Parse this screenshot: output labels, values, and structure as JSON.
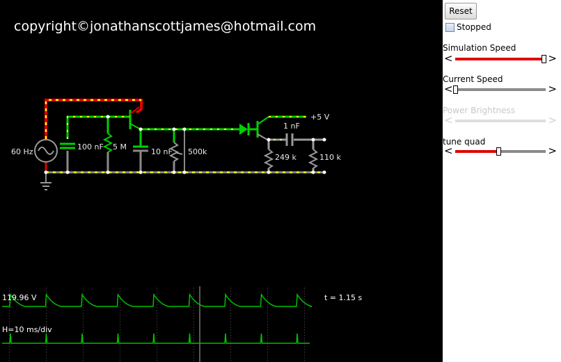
{
  "canvas": {
    "copyright": "copyright©jonathanscottjames@hotmail.com",
    "labels": {
      "source": "60 Hz",
      "cap1": "100 nF",
      "res1": "5 M",
      "cap2": "10 nF",
      "pot": "500k",
      "vcc": "+5 V",
      "cap3": "1 nF",
      "res2": "249 k",
      "res3": "110 k"
    },
    "scope": {
      "voltage": "119.96 V",
      "time": "t = 1.15 s",
      "hdiv": "H=10 ms/div"
    }
  },
  "panel": {
    "reset": "Reset",
    "stopped": "Stopped",
    "stopped_checked": false,
    "controls": [
      {
        "label": "Simulation Speed",
        "value": 0.98,
        "enabled": true
      },
      {
        "label": "Current Speed",
        "value": 0.0,
        "enabled": true
      },
      {
        "label": "Power Brightness",
        "value": 0.5,
        "enabled": false
      },
      {
        "label": "tune quad",
        "value": 0.48,
        "enabled": true
      }
    ]
  }
}
